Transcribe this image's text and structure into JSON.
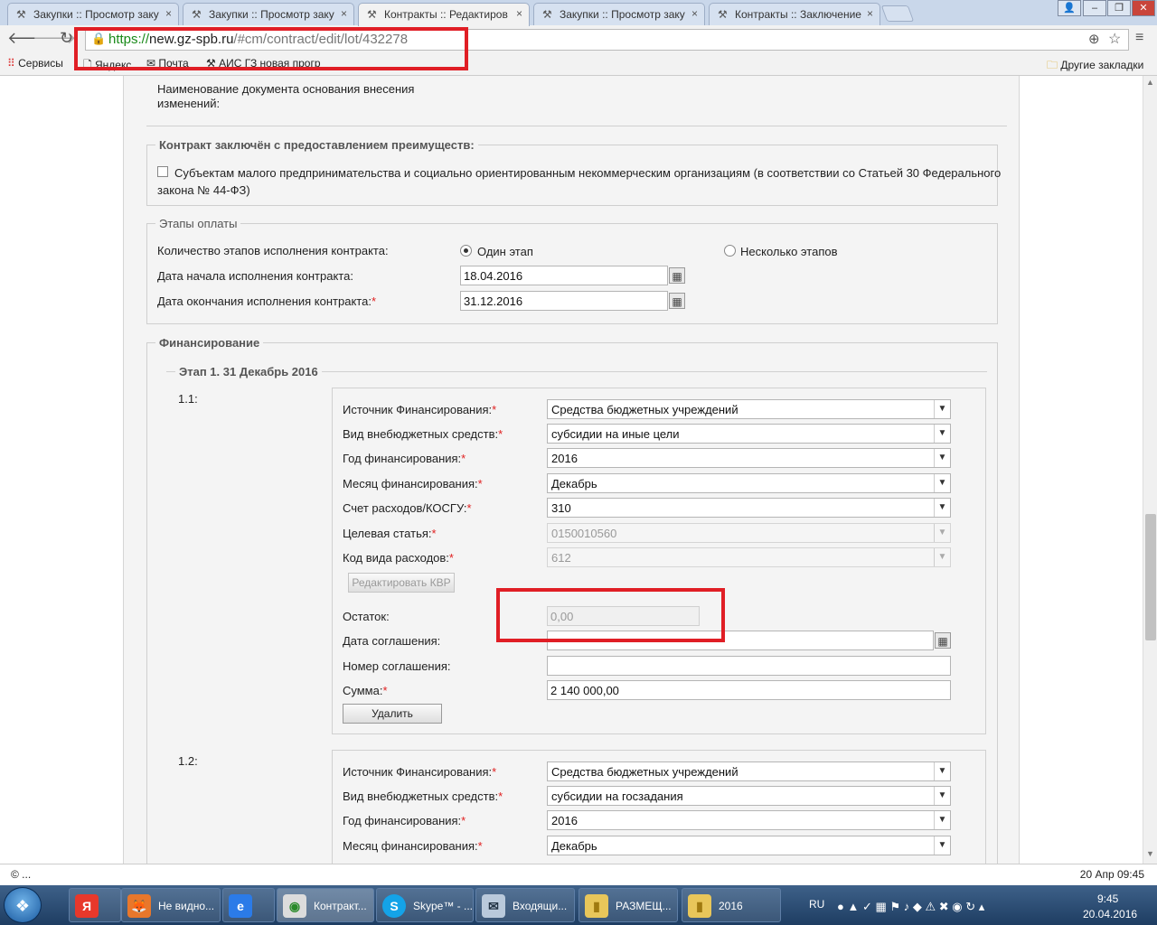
{
  "browser": {
    "tabs": [
      {
        "label": "Закупки :: Просмотр заку",
        "active": false
      },
      {
        "label": "Закупки :: Просмотр заку",
        "active": false
      },
      {
        "label": "Контракты :: Редактиров",
        "active": true
      },
      {
        "label": "Закупки :: Просмотр заку",
        "active": false
      },
      {
        "label": "Контракты :: Заключение",
        "active": false
      }
    ],
    "url_proto": "https://",
    "url_host": "new.gz-spb.ru",
    "url_path": "/#cm/contract/edit/lot/432278",
    "bookmarks": {
      "apps": "Сервисы",
      "yandex": "Яндекс",
      "mail": "Почта",
      "ais": "АИС ГЗ новая прогр",
      "other": "Другие закладки"
    }
  },
  "form": {
    "doc_basis_label_line1": "Наименование документа основания внесения",
    "doc_basis_label_line2": "изменений:",
    "advantages_legend": "Контракт заключён с предоставлением преимуществ:",
    "advantages_checkbox_line1": "Субъектам малого предпринимательства и социально ориентированным некоммерческим организациям (в соответствии со Статьей 30 Федерального",
    "advantages_checkbox_line2": "закона № 44-ФЗ)",
    "payment_legend": "Этапы оплаты",
    "stages_count_label": "Количество этапов исполнения контракта:",
    "radio_one_stage": "Один этап",
    "radio_several_stages": "Несколько этапов",
    "start_date_label": "Дата начала исполнения контракта:",
    "start_date_value": "18.04.2016",
    "end_date_label": "Дата окончания исполнения контракта:",
    "end_date_value": "31.12.2016",
    "financing_legend": "Финансирование",
    "stage_legend": "Этап 1. 31 Декабрь 2016",
    "row1_label": "1.1:",
    "row2_label": "1.2:",
    "fields": {
      "source_label": "Источник Финансирования:",
      "extrabudget_label": "Вид внебюджетных средств:",
      "year_label": "Год финансирования:",
      "month_label": "Месяц финансирования:",
      "account_label": "Счет расходов/КОСГУ:",
      "target_label": "Целевая статья:",
      "kvr_label": "Код вида расходов:",
      "edit_kvr_button": "Редактировать КВР",
      "remainder_label": "Остаток:",
      "agreement_date_label": "Дата соглашения:",
      "agreement_number_label": "Номер соглашения:",
      "sum_label": "Сумма:",
      "delete_button": "Удалить"
    },
    "row1": {
      "source": "Средства бюджетных учреждений",
      "extrabudget": "субсидии на иные цели",
      "year": "2016",
      "month": "Декабрь",
      "account": "310",
      "target": "0150010560",
      "kvr": "612",
      "remainder": "0,00",
      "agreement_date": "",
      "agreement_number": "",
      "sum": "2 140 000,00"
    },
    "row2": {
      "source": "Средства бюджетных учреждений",
      "extrabudget": "субсидии на госзадания",
      "year": "2016",
      "month": "Декабрь"
    },
    "required_mark": "*"
  },
  "status": {
    "left": "© ...",
    "right": "20 Апр 09:45"
  },
  "taskbar": {
    "start": "❖",
    "tasks": [
      {
        "label": "",
        "icon": "Я",
        "color": "#e8382b"
      },
      {
        "label": "Не видно...",
        "icon": "🦊",
        "color": "#e8772b"
      },
      {
        "label": "",
        "icon": "e",
        "color": "#2b7be8"
      },
      {
        "label": "Контракт...",
        "icon": "◉",
        "color": "#dcdcdc"
      },
      {
        "label": "Skype™ - ...",
        "icon": "S",
        "color": "#14a3e8"
      },
      {
        "label": "Входящи...",
        "icon": "✉",
        "color": "#b9c9db"
      },
      {
        "label": "РАЗМЕЩ...",
        "icon": "▮",
        "color": "#e8c65a"
      },
      {
        "label": "2016",
        "icon": "▮",
        "color": "#e8c65a"
      }
    ],
    "lang": "RU",
    "clock_time": "9:45",
    "clock_date": "20.04.2016"
  }
}
